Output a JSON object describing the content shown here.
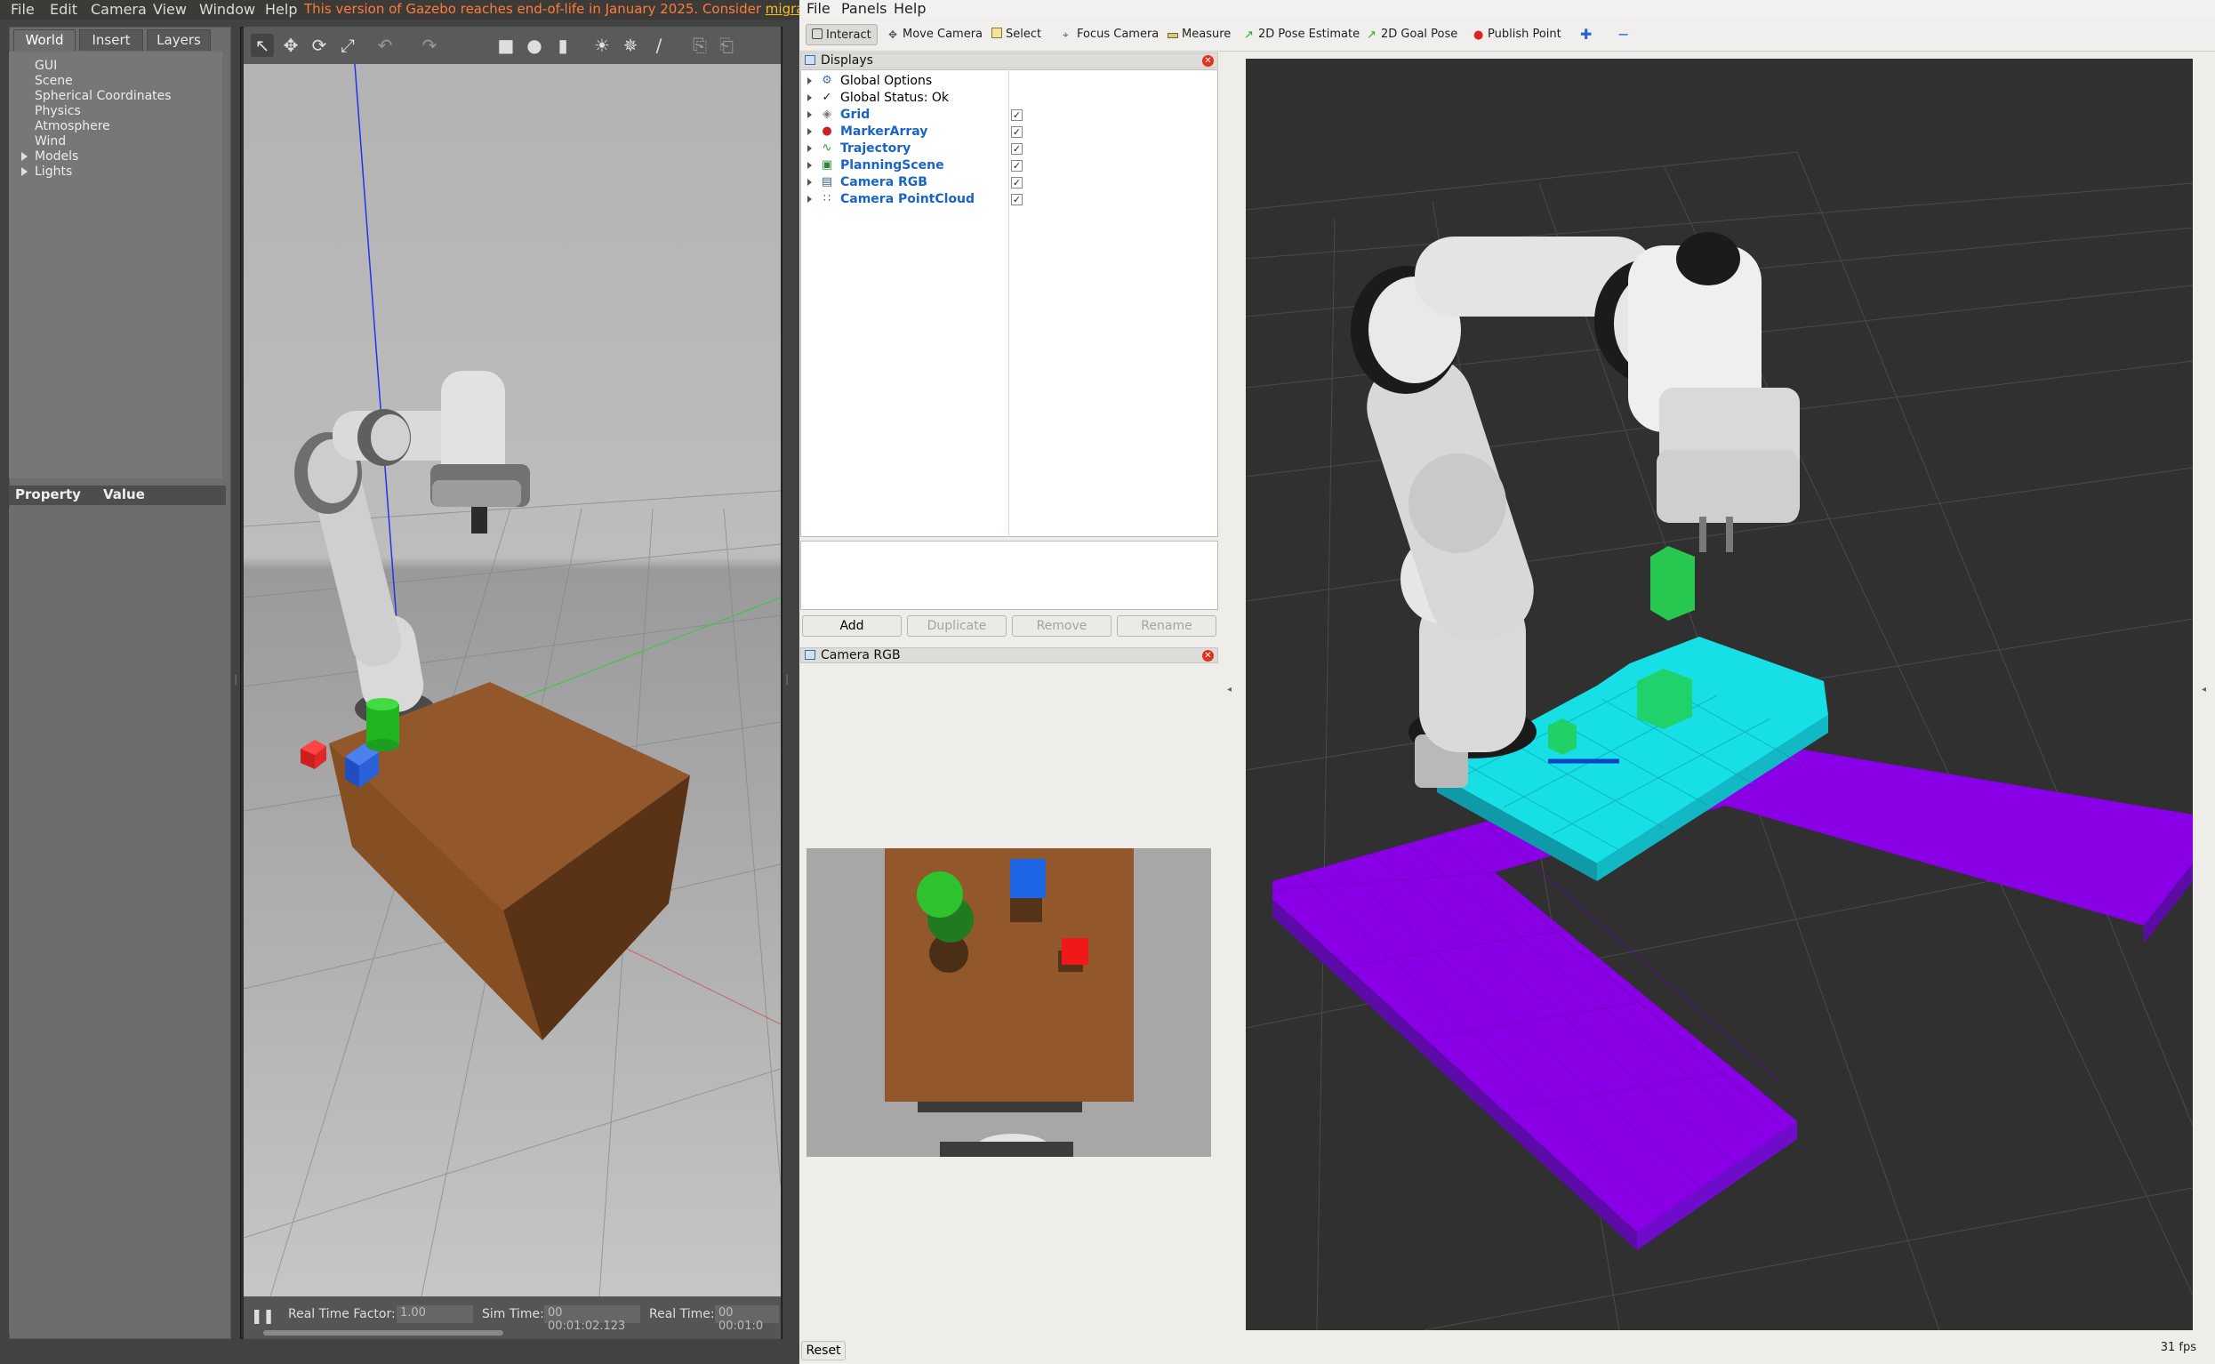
{
  "gazebo": {
    "menu": [
      "File",
      "Edit",
      "Camera",
      "View",
      "Window",
      "Help"
    ],
    "warning_text": "This version of Gazebo reaches end-of-life in January 2025. Consider ",
    "warning_link": "migrating to t",
    "tabs": [
      "World",
      "Insert",
      "Layers"
    ],
    "tree": [
      "GUI",
      "Scene",
      "Spherical Coordinates",
      "Physics",
      "Atmosphere",
      "Wind",
      "Models",
      "Lights"
    ],
    "property_header": {
      "property": "Property",
      "value": "Value"
    },
    "status": {
      "rtf_label": "Real Time Factor:",
      "rtf_value": "1.00",
      "sim_label": "Sim Time:",
      "sim_value": "00 00:01:02.123",
      "real_label": "Real Time:",
      "real_value": "00 00:01:0"
    }
  },
  "rviz": {
    "menu": [
      "File",
      "Panels",
      "Help"
    ],
    "toolbar": [
      "Interact",
      "Move Camera",
      "Select",
      "Focus Camera",
      "Measure",
      "2D Pose Estimate",
      "2D Goal Pose",
      "Publish Point"
    ],
    "displays_title": "Displays",
    "displays": [
      {
        "name": "Global Options",
        "plugin": false,
        "checked": null,
        "icon": "gear-icon"
      },
      {
        "name": "Global Status: Ok",
        "plugin": false,
        "checked": null,
        "icon": "check-icon"
      },
      {
        "name": "Grid",
        "plugin": true,
        "checked": true,
        "icon": "grid-icon"
      },
      {
        "name": "MarkerArray",
        "plugin": true,
        "checked": true,
        "icon": "marker-icon"
      },
      {
        "name": "Trajectory",
        "plugin": true,
        "checked": true,
        "icon": "trajectory-icon"
      },
      {
        "name": "PlanningScene",
        "plugin": true,
        "checked": true,
        "icon": "planning-icon"
      },
      {
        "name": "Camera RGB",
        "plugin": true,
        "checked": true,
        "icon": "camera-icon"
      },
      {
        "name": "Camera PointCloud",
        "plugin": true,
        "checked": true,
        "icon": "pointcloud-icon"
      }
    ],
    "buttons": [
      "Add",
      "Duplicate",
      "Remove",
      "Rename"
    ],
    "camera_panel_title": "Camera RGB",
    "reset_label": "Reset",
    "fps": "31 fps"
  }
}
